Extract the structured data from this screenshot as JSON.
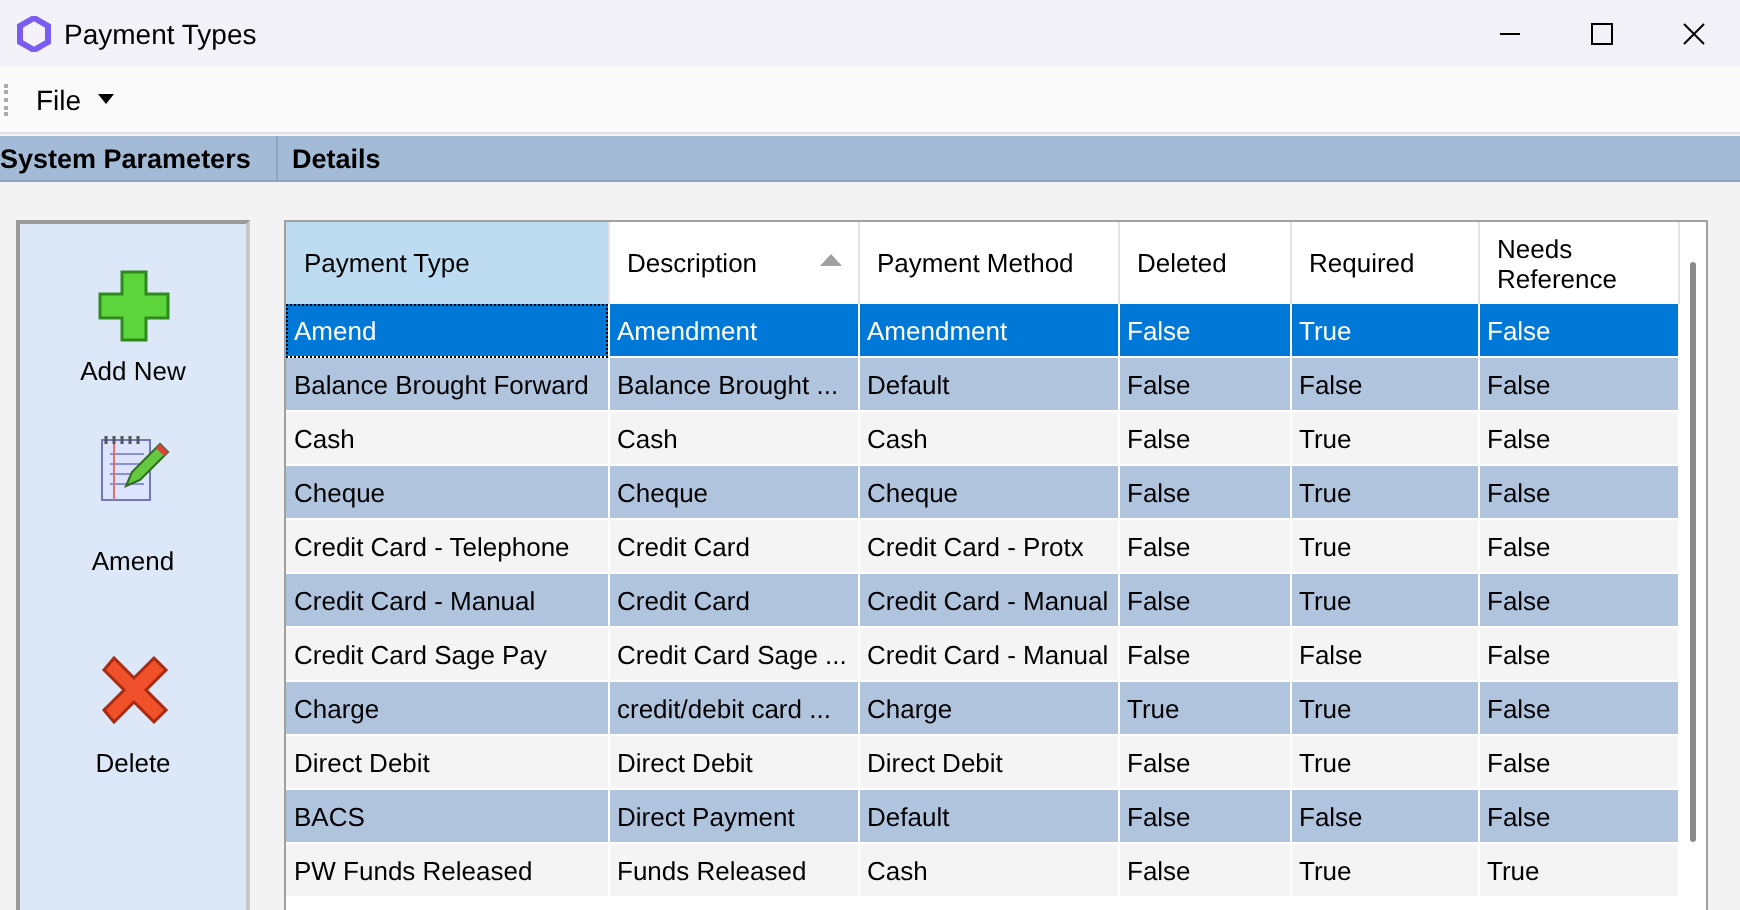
{
  "window": {
    "title": "Payment Types"
  },
  "menu": [
    {
      "label": "File"
    }
  ],
  "section_headers": [
    "System Parameters",
    "Details"
  ],
  "actions": [
    {
      "kind": "add",
      "label": "Add New"
    },
    {
      "kind": "amend",
      "label": "Amend"
    },
    {
      "kind": "delete",
      "label": "Delete"
    }
  ],
  "table": {
    "columns": [
      {
        "label": "Payment Type",
        "sorted": false,
        "highlighted": true
      },
      {
        "label": "Description",
        "sorted": true,
        "highlighted": false
      },
      {
        "label": "Payment Method",
        "sorted": false,
        "highlighted": false
      },
      {
        "label": "Deleted",
        "sorted": false,
        "highlighted": false
      },
      {
        "label": "Required",
        "sorted": false,
        "highlighted": false
      },
      {
        "label": "Needs Reference",
        "sorted": false,
        "highlighted": false
      }
    ],
    "rows": [
      {
        "selected": true,
        "cells": [
          "Amend",
          "Amendment",
          "Amendment",
          "False",
          "True",
          "False"
        ]
      },
      {
        "selected": false,
        "cells": [
          "Balance Brought Forward",
          "Balance Brought ...",
          "Default",
          "False",
          "False",
          "False"
        ]
      },
      {
        "selected": false,
        "cells": [
          "Cash",
          "Cash",
          "Cash",
          "False",
          "True",
          "False"
        ]
      },
      {
        "selected": false,
        "cells": [
          "Cheque",
          "Cheque",
          "Cheque",
          "False",
          "True",
          "False"
        ]
      },
      {
        "selected": false,
        "cells": [
          "Credit Card - Telephone",
          "Credit Card",
          "Credit Card - Protx",
          "False",
          "True",
          "False"
        ]
      },
      {
        "selected": false,
        "cells": [
          "Credit Card - Manual",
          "Credit Card",
          "Credit Card - Manual",
          "False",
          "True",
          "False"
        ]
      },
      {
        "selected": false,
        "cells": [
          "Credit Card Sage Pay",
          "Credit Card Sage ...",
          "Credit Card - Manual",
          "False",
          "False",
          "False"
        ]
      },
      {
        "selected": false,
        "cells": [
          "Charge",
          "credit/debit card ...",
          "Charge",
          "True",
          "True",
          "False"
        ]
      },
      {
        "selected": false,
        "cells": [
          "Direct Debit",
          "Direct Debit",
          "Direct Debit",
          "False",
          "True",
          "False"
        ]
      },
      {
        "selected": false,
        "cells": [
          "BACS",
          "Direct Payment",
          "Default",
          "False",
          "False",
          "False"
        ]
      },
      {
        "selected": false,
        "cells": [
          "PW Funds Released",
          "Funds Released",
          "Cash",
          "False",
          "True",
          "True"
        ]
      }
    ]
  }
}
